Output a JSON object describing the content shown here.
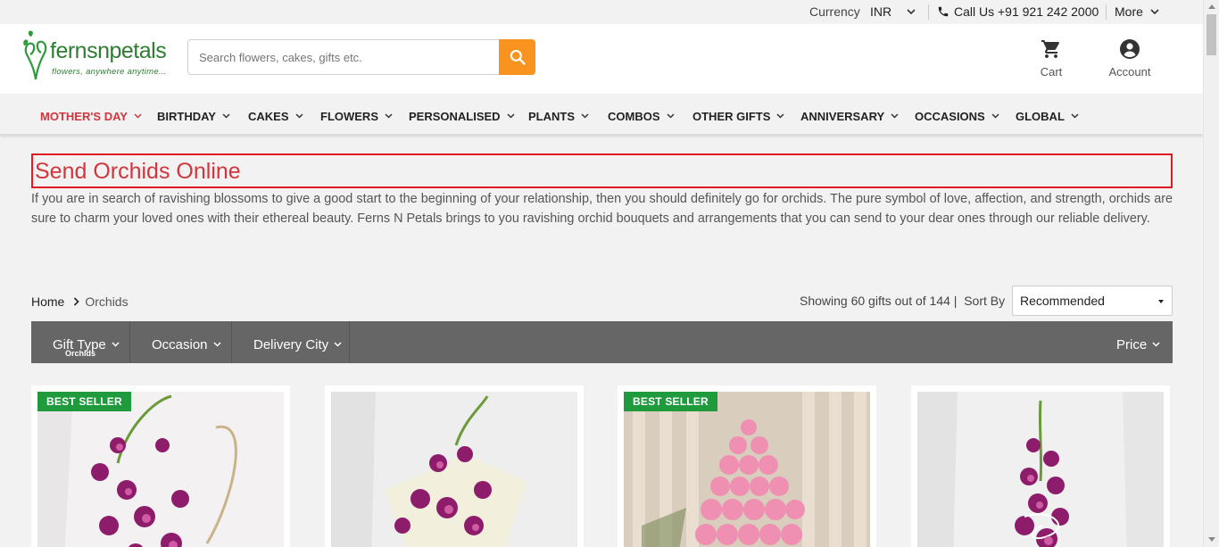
{
  "topbar": {
    "currency_label": "Currency",
    "currency_value": "INR",
    "call_label": "Call Us +91 921 242 2000",
    "more_label": "More"
  },
  "header": {
    "logo_brand": "fernsnpetals",
    "logo_tagline": "flowers, anywhere anytime...",
    "search_placeholder": "Search flowers, cakes, gifts etc.",
    "cart_label": "Cart",
    "account_label": "Account"
  },
  "nav": {
    "items": [
      "MOTHER'S DAY",
      "BIRTHDAY",
      "CAKES",
      "FLOWERS",
      "PERSONALISED",
      "PLANTS",
      "COMBOS",
      "OTHER GIFTS",
      "ANNIVERSARY",
      "OCCASIONS",
      "GLOBAL"
    ]
  },
  "page": {
    "title": "Send Orchids Online",
    "description": "If you are in search of ravishing blossoms to give a good start to the beginning of your relationship, then you should definitely go for orchids. The pure symbol of love, affection, and strength, orchids are sure to charm your loved ones with their ethereal beauty. Ferns N Petals brings to you ravishing orchid bouquets and arrangements that you can send to your dear ones through our reliable delivery."
  },
  "breadcrumb": {
    "home": "Home",
    "current": "Orchids"
  },
  "listing": {
    "showing": "Showing 60 gifts out of 144 |",
    "sort_label": "Sort By",
    "sort_value": "Recommended"
  },
  "filters": {
    "gift_type": "Gift Type",
    "gift_type_value": "Orchids",
    "occasion": "Occasion",
    "delivery_city": "Delivery City",
    "price": "Price"
  },
  "products": [
    {
      "badge": "BEST SELLER"
    },
    {
      "badge": ""
    },
    {
      "badge": "BEST SELLER"
    },
    {
      "badge": ""
    }
  ],
  "colors": {
    "accent_red": "#d2353c",
    "search_orange": "#f7931e",
    "badge_green": "#1f9a3d",
    "filter_bar": "#666666",
    "brand_green": "#2e7d32"
  }
}
